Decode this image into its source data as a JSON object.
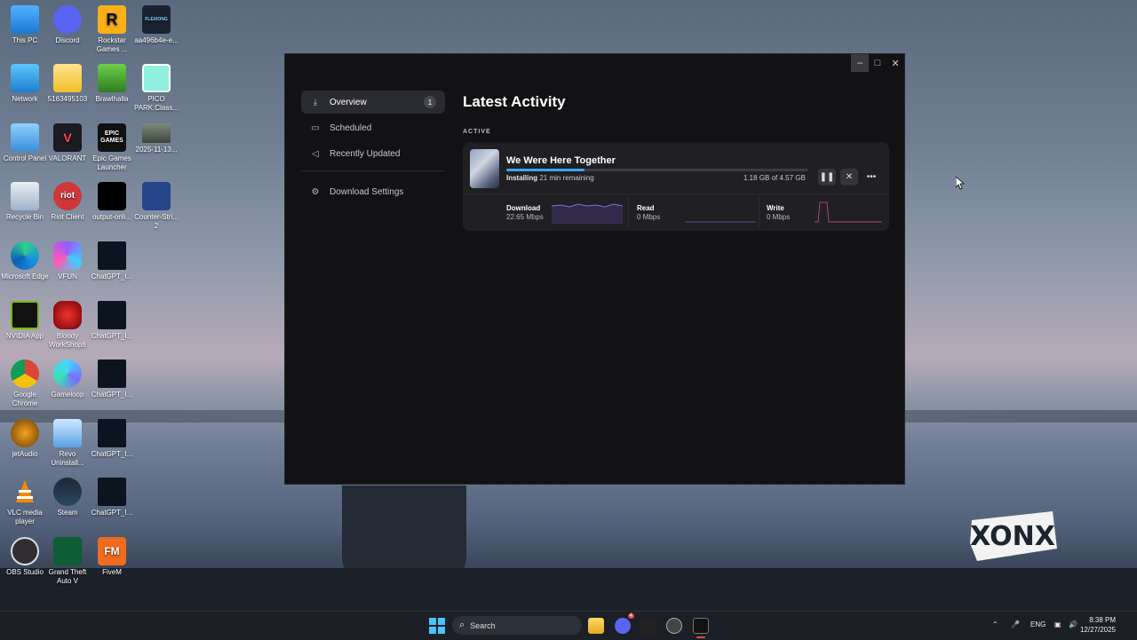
{
  "desktop": {
    "icons": [
      {
        "label": "This PC"
      },
      {
        "label": "Discord"
      },
      {
        "label": "Rockstar Games ..."
      },
      {
        "label": "aa496b4e-e..."
      },
      {
        "label": "Network"
      },
      {
        "label": "5163495103"
      },
      {
        "label": "Brawlhalla"
      },
      {
        "label": "PICO PARK:Class..."
      },
      {
        "label": "Control Panel"
      },
      {
        "label": "VALORANT"
      },
      {
        "label": "Epic Games Launcher"
      },
      {
        "label": "2025-11-13..."
      },
      {
        "label": "Recycle Bin"
      },
      {
        "label": "Riot Client"
      },
      {
        "label": "output-onli..."
      },
      {
        "label": "Counter-Stri... 2"
      },
      {
        "label": "Microsoft Edge"
      },
      {
        "label": "VFUN"
      },
      {
        "label": "ChatGPT_I..."
      },
      {
        "label": "NVIDIA App"
      },
      {
        "label": "Bloody WorkShop8"
      },
      {
        "label": "ChatGPT_I..."
      },
      {
        "label": "Google Chrome"
      },
      {
        "label": "Gameloop"
      },
      {
        "label": "ChatGPT_I..."
      },
      {
        "label": "jetAudio"
      },
      {
        "label": "Revo Uninstall..."
      },
      {
        "label": "ChatGPT_I..."
      },
      {
        "label": "VLC media player"
      },
      {
        "label": "Steam"
      },
      {
        "label": "ChatGPT_I..."
      },
      {
        "label": "OBS Studio"
      },
      {
        "label": "Grand Theft Auto V"
      },
      {
        "label": "FiveM"
      }
    ],
    "icon_text": {
      "rockstar": "R",
      "valorant": "V",
      "epic": "EPIC GAMES",
      "riot": "riot",
      "fivem": "FM",
      "flexiong": "FLEXIONG"
    },
    "watermark": "XONX"
  },
  "launcher": {
    "sidebar": {
      "items": [
        {
          "label": "Overview",
          "badge": "1",
          "icon": "download-icon"
        },
        {
          "label": "Scheduled",
          "icon": "calendar-icon"
        },
        {
          "label": "Recently Updated",
          "icon": "megaphone-icon"
        },
        {
          "label": "Download Settings",
          "icon": "gear-icon"
        }
      ]
    },
    "main": {
      "title": "Latest Activity",
      "section_label": "ACTIVE",
      "download": {
        "game_name": "We Were Here Together",
        "status": "Installing",
        "remaining": "21 min remaining",
        "size": "1.18 GB of 4.57 GB",
        "progress": 0.26,
        "metrics": [
          {
            "label": "Download",
            "value": "22.65 Mbps"
          },
          {
            "label": "Read",
            "value": "0 Mbps"
          },
          {
            "label": "Write",
            "value": "0 Mbps"
          }
        ]
      }
    },
    "accent": "#3fa5ff"
  },
  "taskbar": {
    "search_placeholder": "Search",
    "discord_badge": "4",
    "language": "ENG",
    "time": "8:38 PM",
    "date": "12/27/2025"
  }
}
